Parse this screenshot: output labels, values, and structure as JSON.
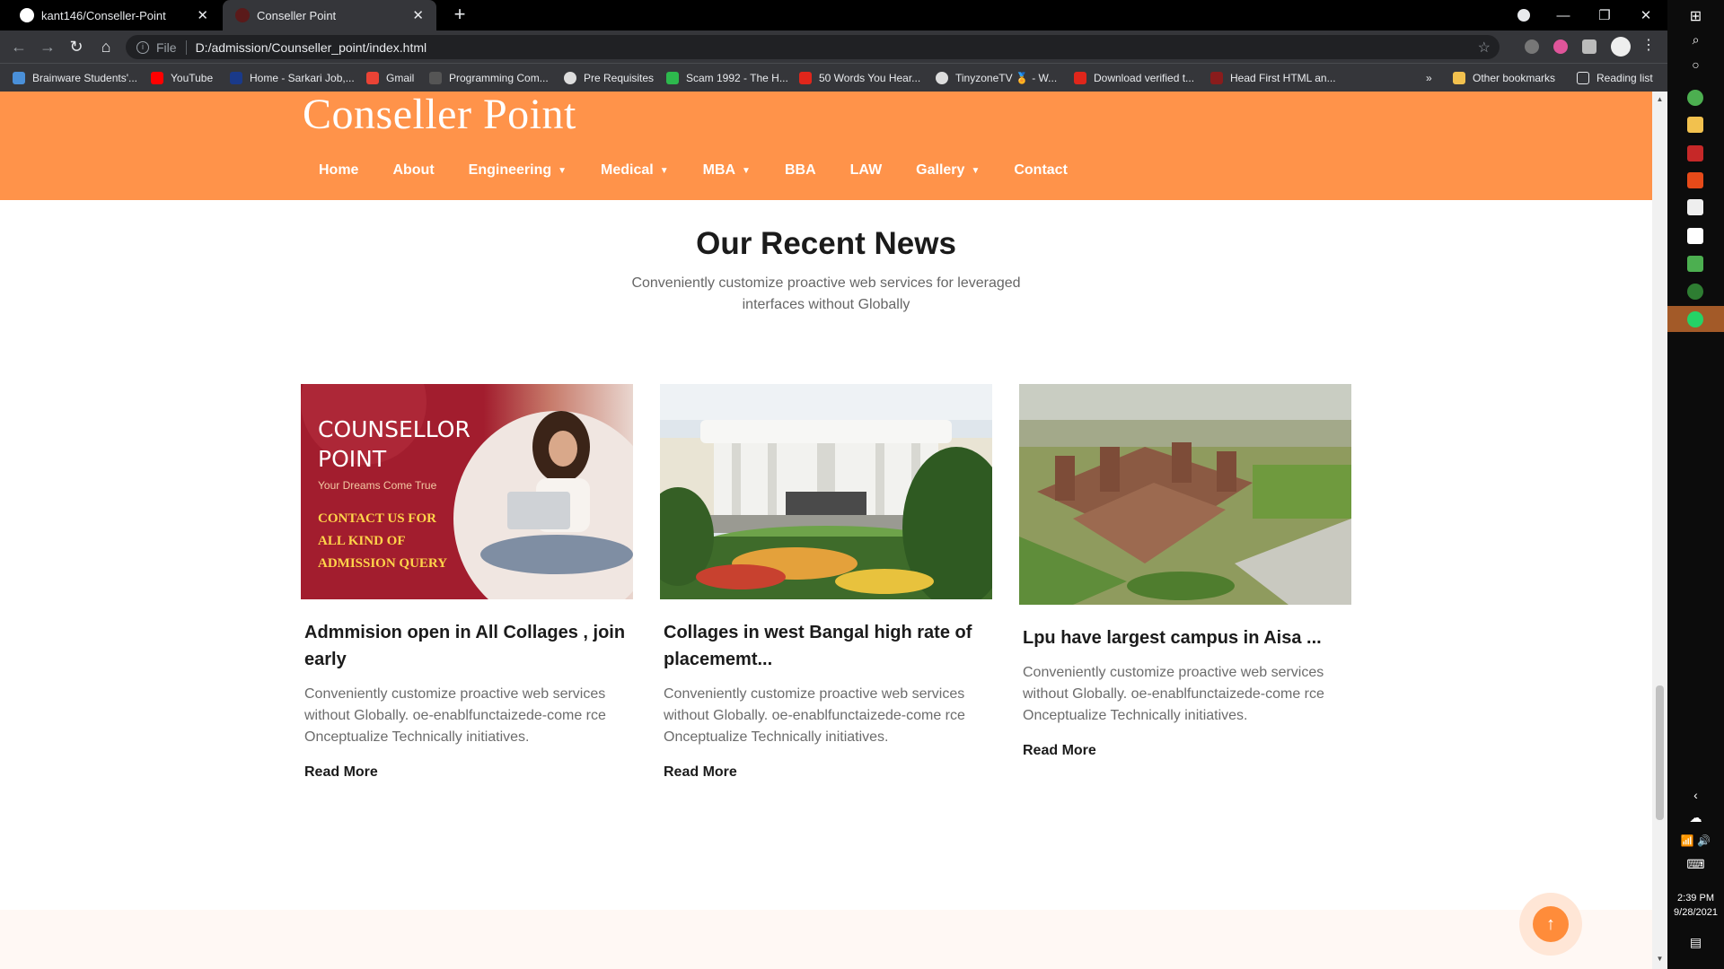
{
  "browser": {
    "tabs": [
      {
        "title": "kant146/Conseller-Point",
        "active": false
      },
      {
        "title": "Conseller Point",
        "active": true
      }
    ],
    "new_tab_glyph": "+",
    "close_glyph": "✕",
    "address": {
      "scheme": "File",
      "url": "D:/admission/Counseller_point/index.html"
    },
    "bookmarks": [
      {
        "label": "Brainware Students'...",
        "icon_color": "#4a90d9"
      },
      {
        "label": "YouTube",
        "icon_color": "#ff0000"
      },
      {
        "label": "Home - Sarkari Job,...",
        "icon_color": "#1a3a8a"
      },
      {
        "label": "Gmail",
        "icon_color": "#ea4335"
      },
      {
        "label": "Programming Com...",
        "icon_color": "#555555"
      },
      {
        "label": "Pre Requisites",
        "icon_color": "#dddddd"
      },
      {
        "label": "Scam 1992 - The H...",
        "icon_color": "#2db84d"
      },
      {
        "label": "50 Words You Hear...",
        "icon_color": "#e0261b"
      },
      {
        "label": "TinyzoneTV 🏅 - W...",
        "icon_color": "#dddddd"
      },
      {
        "label": "Download verified t...",
        "icon_color": "#e0261b"
      },
      {
        "label": "Head First HTML an...",
        "icon_color": "#8a1c1c"
      }
    ],
    "overflow_label": "»",
    "other_bookmarks": "Other bookmarks",
    "reading_list": "Reading list"
  },
  "taskbar": {
    "time": "2:39 PM",
    "date": "9/28/2021"
  },
  "site": {
    "logo": "Conseller Point",
    "nav": [
      {
        "label": "Home",
        "dropdown": false
      },
      {
        "label": "About",
        "dropdown": false
      },
      {
        "label": "Engineering",
        "dropdown": true
      },
      {
        "label": "Medical",
        "dropdown": true
      },
      {
        "label": "MBA",
        "dropdown": true
      },
      {
        "label": "BBA",
        "dropdown": false
      },
      {
        "label": "LAW",
        "dropdown": false
      },
      {
        "label": "Gallery",
        "dropdown": true
      },
      {
        "label": "Contact",
        "dropdown": false
      }
    ],
    "news": {
      "title": "Our Recent News",
      "subtitle": "Conveniently customize proactive web services for leveraged interfaces without Globally",
      "cards": [
        {
          "image_label": "counsellor-point-banner",
          "banner_title_1": "COUNSELLOR",
          "banner_title_2": "POINT",
          "banner_tagline": "Your Dreams Come True",
          "banner_cta_1": "CONTACT US FOR",
          "banner_cta_2": "ALL KIND OF",
          "banner_cta_3": "ADMISSION QUERY",
          "title": "Admmision open in All Collages , join early",
          "text": "Conveniently customize proactive web services without Globally. oe-enablfunctaizede-come rce Onceptualize Technically initiatives.",
          "more": "Read More"
        },
        {
          "image_label": "west-bengal-college-building",
          "title": "Collages in west Bangal high rate of placememt...",
          "text": "Conveniently customize proactive web services without Globally. oe-enablfunctaizede-come rce Onceptualize Technically initiatives.",
          "more": "Read More"
        },
        {
          "image_label": "lpu-campus-aerial",
          "title": "Lpu have largest campus in Aisa ...",
          "text": "Conveniently customize proactive web services without Globally. oe-enablfunctaizede-come rce Onceptualize Technically initiatives.",
          "more": "Read More"
        }
      ]
    },
    "back_to_top_glyph": "↑"
  },
  "colors": {
    "brand": "#ff934a",
    "accent": "#ff8c3a",
    "banner": "#a21d2e",
    "text": "#1b1b1b",
    "muted": "#6c6c6c"
  }
}
